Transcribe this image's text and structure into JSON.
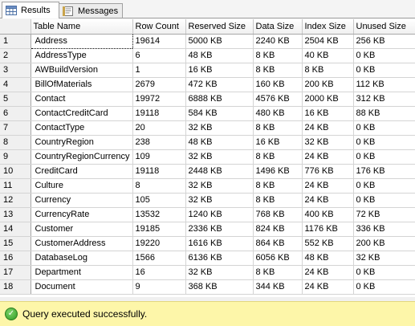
{
  "tabs": [
    {
      "label": "Results",
      "icon": "grid-results-icon",
      "active": true
    },
    {
      "label": "Messages",
      "icon": "messages-icon",
      "active": false
    }
  ],
  "columns": [
    "Table Name",
    "Row Count",
    "Reserved Size",
    "Data Size",
    "Index Size",
    "Unused Size"
  ],
  "rows": [
    {
      "n": "1",
      "cells": [
        "Address",
        "19614",
        "5000 KB",
        "2240 KB",
        "2504 KB",
        "256 KB"
      ]
    },
    {
      "n": "2",
      "cells": [
        "AddressType",
        "6",
        "48 KB",
        "8 KB",
        "40 KB",
        "0 KB"
      ]
    },
    {
      "n": "3",
      "cells": [
        "AWBuildVersion",
        "1",
        "16 KB",
        "8 KB",
        "8 KB",
        "0 KB"
      ]
    },
    {
      "n": "4",
      "cells": [
        "BillOfMaterials",
        "2679",
        "472 KB",
        "160 KB",
        "200 KB",
        "112 KB"
      ]
    },
    {
      "n": "5",
      "cells": [
        "Contact",
        "19972",
        "6888 KB",
        "4576 KB",
        "2000 KB",
        "312 KB"
      ]
    },
    {
      "n": "6",
      "cells": [
        "ContactCreditCard",
        "19118",
        "584 KB",
        "480 KB",
        "16 KB",
        "88 KB"
      ]
    },
    {
      "n": "7",
      "cells": [
        "ContactType",
        "20",
        "32 KB",
        "8 KB",
        "24 KB",
        "0 KB"
      ]
    },
    {
      "n": "8",
      "cells": [
        "CountryRegion",
        "238",
        "48 KB",
        "16 KB",
        "32 KB",
        "0 KB"
      ]
    },
    {
      "n": "9",
      "cells": [
        "CountryRegionCurrency",
        "109",
        "32 KB",
        "8 KB",
        "24 KB",
        "0 KB"
      ]
    },
    {
      "n": "10",
      "cells": [
        "CreditCard",
        "19118",
        "2448 KB",
        "1496 KB",
        "776 KB",
        "176 KB"
      ]
    },
    {
      "n": "11",
      "cells": [
        "Culture",
        "8",
        "32 KB",
        "8 KB",
        "24 KB",
        "0 KB"
      ]
    },
    {
      "n": "12",
      "cells": [
        "Currency",
        "105",
        "32 KB",
        "8 KB",
        "24 KB",
        "0 KB"
      ]
    },
    {
      "n": "13",
      "cells": [
        "CurrencyRate",
        "13532",
        "1240 KB",
        "768 KB",
        "400 KB",
        "72 KB"
      ]
    },
    {
      "n": "14",
      "cells": [
        "Customer",
        "19185",
        "2336 KB",
        "824 KB",
        "1176 KB",
        "336 KB"
      ]
    },
    {
      "n": "15",
      "cells": [
        "CustomerAddress",
        "19220",
        "1616 KB",
        "864 KB",
        "552 KB",
        "200 KB"
      ]
    },
    {
      "n": "16",
      "cells": [
        "DatabaseLog",
        "1566",
        "6136 KB",
        "6056 KB",
        "48 KB",
        "32 KB"
      ]
    },
    {
      "n": "17",
      "cells": [
        "Department",
        "16",
        "32 KB",
        "8 KB",
        "24 KB",
        "0 KB"
      ]
    },
    {
      "n": "18",
      "cells": [
        "Document",
        "9",
        "368 KB",
        "344 KB",
        "24 KB",
        "0 KB"
      ]
    }
  ],
  "status": {
    "text": "Query executed successfully.",
    "icon": "success-check-icon",
    "color": "#fdf6a9"
  }
}
